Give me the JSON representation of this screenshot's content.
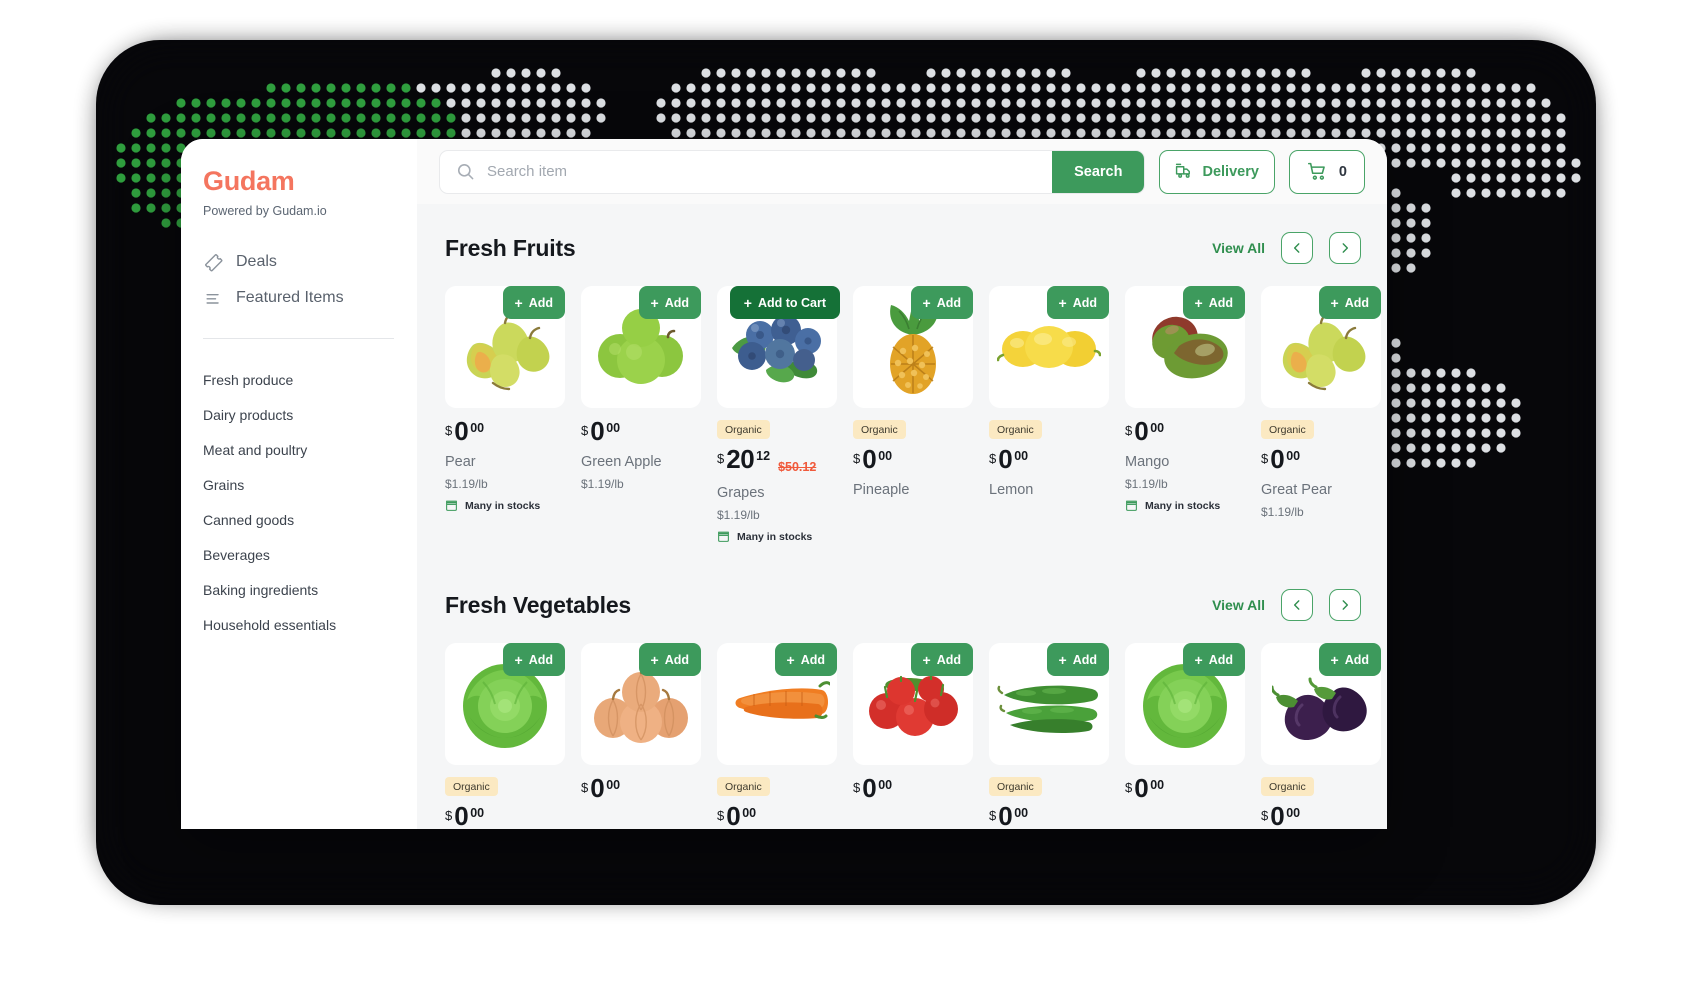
{
  "brand": {
    "name": "Gudam",
    "tagline": "Powered by Gudam.io",
    "color": "#f4755f"
  },
  "sidebar": {
    "nav": [
      {
        "label": "Deals",
        "icon": "ticket-icon"
      },
      {
        "label": "Featured Items",
        "icon": "sort-lines-icon"
      }
    ],
    "categories": [
      "Fresh produce",
      "Dairy products",
      "Meat and poultry",
      "Grains",
      "Canned goods",
      "Beverages",
      "Baking ingredients",
      "Household essentials"
    ]
  },
  "topbar": {
    "search_placeholder": "Search item",
    "search_value": "",
    "search_button": "Search",
    "delivery_button": "Delivery",
    "cart_count": "0",
    "accent_green": "#3d9a5c"
  },
  "sections": [
    {
      "title": "Fresh Fruits",
      "view_all": "View All",
      "prev": "‹",
      "next": "›",
      "products": [
        {
          "name": "Pear",
          "currency": "$",
          "int": "0",
          "dec": "00",
          "old": "",
          "unit": "$1.19/lb",
          "stock": "Many in stocks",
          "badge": "",
          "add": "Add",
          "image": "pears"
        },
        {
          "name": "Green Apple",
          "currency": "$",
          "int": "0",
          "dec": "00",
          "old": "",
          "unit": "$1.19/lb",
          "stock": "",
          "badge": "",
          "add": "Add",
          "image": "green-apples"
        },
        {
          "name": "Grapes",
          "currency": "$",
          "int": "20",
          "dec": "12",
          "old": "$50.12",
          "unit": "$1.19/lb",
          "stock": "Many in stocks",
          "badge": "Organic",
          "add": "Add to Cart",
          "image": "blueberries"
        },
        {
          "name": "Pineaple",
          "currency": "$",
          "int": "0",
          "dec": "00",
          "old": "",
          "unit": "",
          "stock": "",
          "badge": "Organic",
          "add": "Add",
          "image": "pineapple"
        },
        {
          "name": "Lemon",
          "currency": "$",
          "int": "0",
          "dec": "00",
          "old": "",
          "unit": "",
          "stock": "",
          "badge": "Organic",
          "add": "Add",
          "image": "lemons"
        },
        {
          "name": "Mango",
          "currency": "$",
          "int": "0",
          "dec": "00",
          "old": "",
          "unit": "$1.19/lb",
          "stock": "Many in stocks",
          "badge": "",
          "add": "Add",
          "image": "mangoes"
        },
        {
          "name": "Great Pear",
          "currency": "$",
          "int": "0",
          "dec": "00",
          "old": "",
          "unit": "$1.19/lb",
          "stock": "",
          "badge": "Organic",
          "add": "Add",
          "image": "pears"
        }
      ]
    },
    {
      "title": "Fresh Vegetables",
      "view_all": "View All",
      "prev": "‹",
      "next": "›",
      "products": [
        {
          "name": "",
          "currency": "$",
          "int": "0",
          "dec": "00",
          "old": "",
          "unit": "",
          "stock": "",
          "badge": "Organic",
          "add": "Add",
          "image": "lettuce"
        },
        {
          "name": "",
          "currency": "$",
          "int": "0",
          "dec": "00",
          "old": "",
          "unit": "",
          "stock": "",
          "badge": "",
          "add": "Add",
          "image": "onions"
        },
        {
          "name": "",
          "currency": "$",
          "int": "0",
          "dec": "00",
          "old": "",
          "unit": "",
          "stock": "",
          "badge": "Organic",
          "add": "Add",
          "image": "carrots"
        },
        {
          "name": "",
          "currency": "$",
          "int": "0",
          "dec": "00",
          "old": "",
          "unit": "",
          "stock": "",
          "badge": "",
          "add": "Add",
          "image": "tomatoes"
        },
        {
          "name": "",
          "currency": "$",
          "int": "0",
          "dec": "00",
          "old": "",
          "unit": "",
          "stock": "",
          "badge": "Organic",
          "add": "Add",
          "image": "cucumbers"
        },
        {
          "name": "",
          "currency": "$",
          "int": "0",
          "dec": "00",
          "old": "",
          "unit": "",
          "stock": "",
          "badge": "",
          "add": "Add",
          "image": "lettuce"
        },
        {
          "name": "",
          "currency": "$",
          "int": "0",
          "dec": "00",
          "old": "",
          "unit": "",
          "stock": "",
          "badge": "Organic",
          "add": "Add",
          "image": "eggplants"
        }
      ]
    }
  ]
}
